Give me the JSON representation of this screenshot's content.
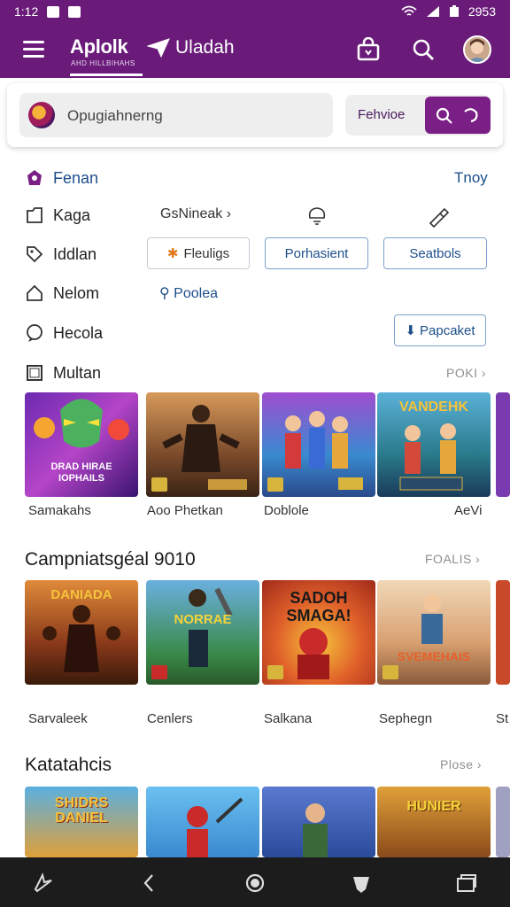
{
  "status": {
    "time": "1:12",
    "right": "2953"
  },
  "appbar": {
    "brand": "Aplolk",
    "brand_sub": "AHD HILLBIHAHS",
    "brand2": "Uladah"
  },
  "search": {
    "placeholder": "Opugiahnerng",
    "filter_label": "Fehvioe"
  },
  "rows": [
    {
      "label": "Fenan",
      "right": "Tnoy"
    },
    {
      "label": "Kaga",
      "mid": "GsNineak"
    },
    {
      "label": "Iddlan"
    },
    {
      "label": "Nelom",
      "mid": "Poolea"
    },
    {
      "label": "Hecola"
    },
    {
      "label": "Multan",
      "right": "POKI"
    }
  ],
  "chips": [
    "Fleuligs",
    "Porhasient",
    "Seatbols",
    "Papcaket"
  ],
  "section1": {
    "captions": [
      "Samakahs",
      "Aoo Phetkan",
      "Doblole",
      "AeVi"
    ],
    "poster_texts": [
      "DRAD HIRAE\nIOPHAILS",
      "",
      "",
      "VANDEHK"
    ]
  },
  "section2": {
    "title": "Campniatsgéal 9010",
    "see_all": "FOALIS",
    "captions": [
      "Sarvaleek",
      "Cenlers",
      "Salkana",
      "Sephegn",
      "St"
    ],
    "poster_texts": [
      "DANIADA",
      "NORRAE",
      "SADOH\nSMAGA!",
      "SVEMEHAIS"
    ]
  },
  "section3": {
    "title": "Katatahcis",
    "see_all": "Plose",
    "poster_texts": [
      "SHIDRS\nDANIEL",
      "",
      "",
      "HUNIER"
    ]
  },
  "colors": {
    "brand": "#6a1b7a",
    "accent": "#7a1f85",
    "link": "#1c4e8a"
  }
}
